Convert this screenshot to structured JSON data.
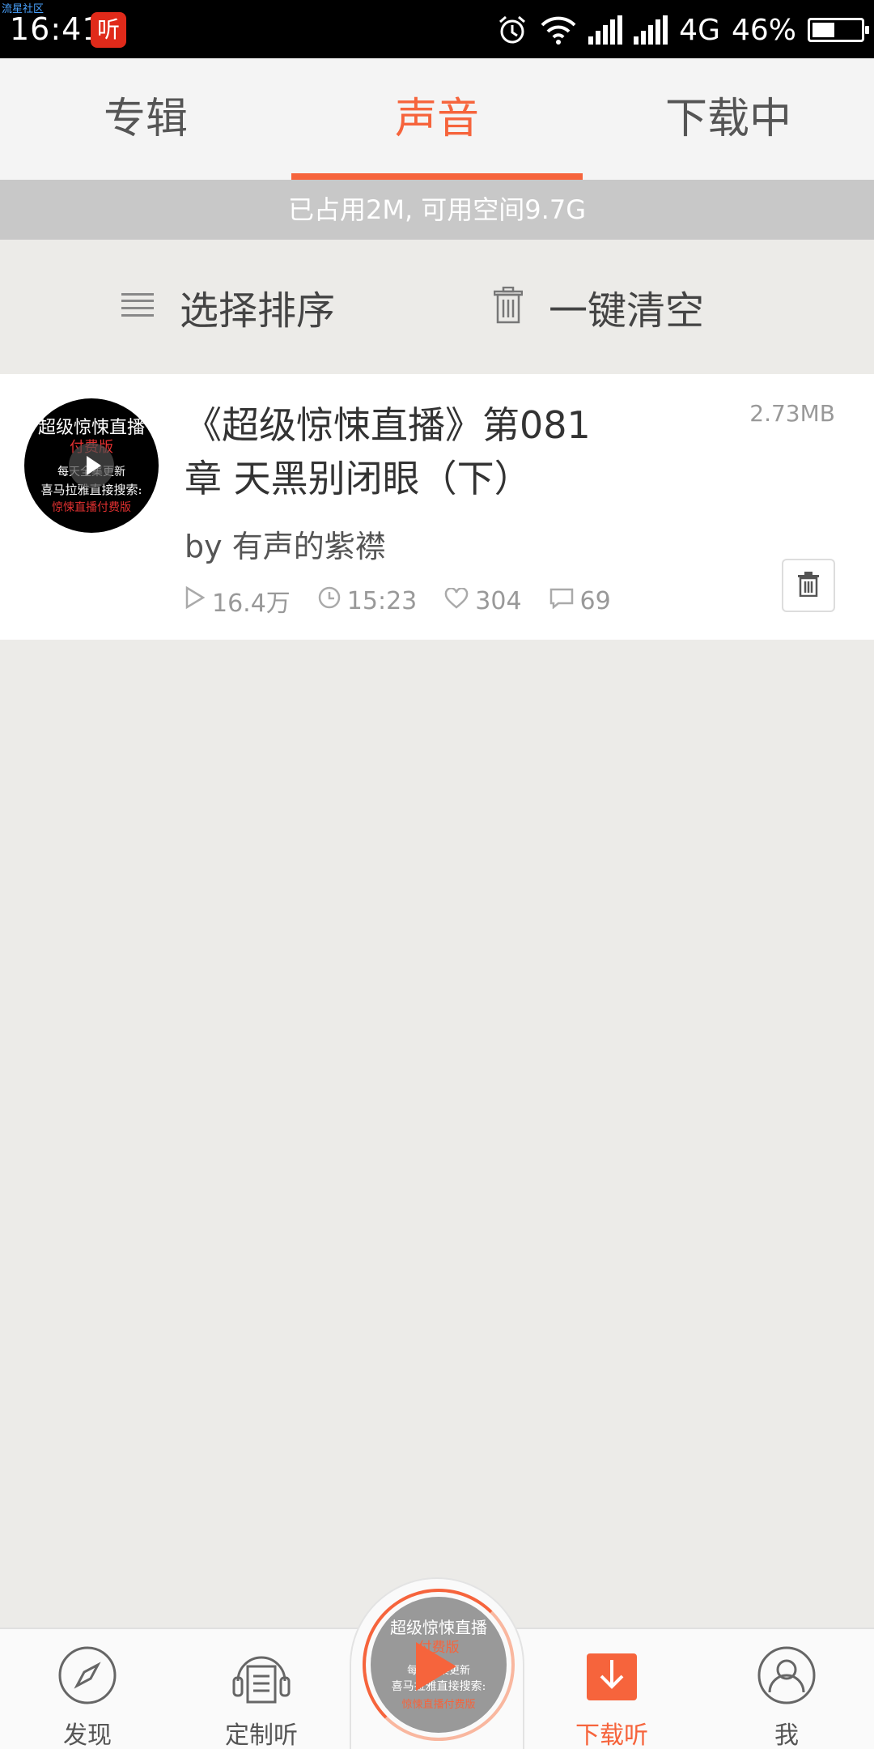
{
  "status_bar": {
    "watermark": "流星社区",
    "time": "16:41",
    "app_badge": "听",
    "network": "4G",
    "battery_percent": "46%",
    "battery_level": 0.46
  },
  "tabs": [
    {
      "label": "专辑",
      "active": false
    },
    {
      "label": "声音",
      "active": true
    },
    {
      "label": "下载中",
      "active": false
    }
  ],
  "storage": {
    "text": "已占用2M, 可用空间9.7G"
  },
  "actions": {
    "sort_label": "选择排序",
    "clear_label": "一键清空"
  },
  "track": {
    "title_line1": "《超级惊悚直播》第081",
    "title_line2": "章 天黑别闭眼（下）",
    "size": "2.73MB",
    "author": "by 有声的紫襟",
    "plays": "16.4万",
    "duration": "15:23",
    "likes": "304",
    "comments": "69",
    "cover": {
      "line1": "超级惊悚直播",
      "line2": "付费版",
      "line3": "每天全集更新",
      "line4": "喜马拉雅直接搜索:",
      "line5": "惊悚直播付费版"
    }
  },
  "bottom_nav": [
    {
      "label": "发现",
      "icon": "compass-icon",
      "active": false
    },
    {
      "label": "定制听",
      "icon": "headphones-icon",
      "active": false
    },
    {
      "label": "下载听",
      "icon": "download-icon",
      "active": true
    },
    {
      "label": "我",
      "icon": "user-icon",
      "active": false
    }
  ],
  "colors": {
    "accent": "#f6643c",
    "status_bar": "#000000",
    "storage_bar": "#c8c8c8"
  }
}
